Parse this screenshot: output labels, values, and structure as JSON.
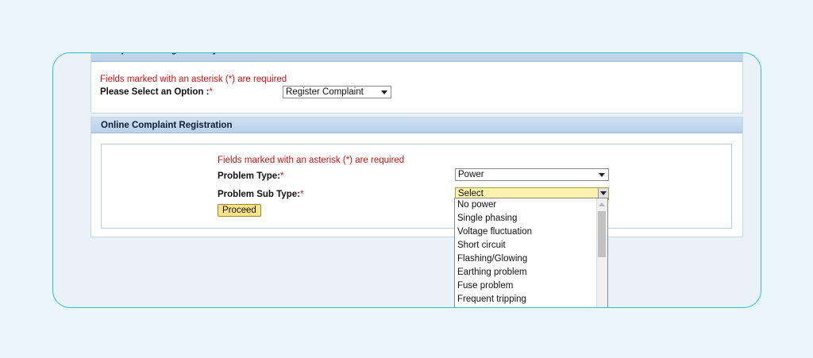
{
  "panel1": {
    "title": "Complaint Management System",
    "required_note": "Fields marked with an asterisk (*) are required",
    "option_label": "Please Select an Option :",
    "asterisk": "*",
    "option_value": "Register Complaint"
  },
  "panel2": {
    "title": "Online Complaint Registration",
    "required_note": "Fields marked with an asterisk (*) are required",
    "problem_type_label": "Problem Type:",
    "problem_type_value": "Power",
    "problem_sub_type_label": "Problem Sub Type:",
    "problem_sub_type_value": "Select",
    "asterisk": "*",
    "proceed_label": "Proceed",
    "sub_type_options": [
      "No power",
      "Single phasing",
      "Voltage fluctuation",
      "Short circuit",
      "Flashing/Glowing",
      "Earthing problem",
      "Fuse problem",
      "Frequent tripping"
    ]
  }
}
